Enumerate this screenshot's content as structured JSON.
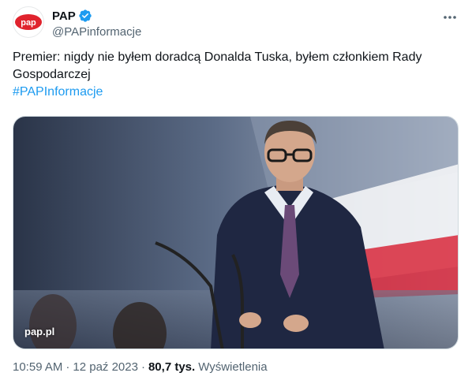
{
  "author": {
    "display_name": "PAP",
    "handle": "@PAPinformacje",
    "avatar_text": "pap",
    "verified_icon": "verified-badge-icon"
  },
  "tweet": {
    "text": "Premier: nigdy nie byłem doradcą Donalda Tuska, byłem członkiem Rady Gospodarczej",
    "hashtag": "#PAPInformacje"
  },
  "media": {
    "watermark": "pap.pl"
  },
  "meta": {
    "time": "10:59 AM",
    "date": "12 paź 2023",
    "separator": "·",
    "views_count": "80,7 tys.",
    "views_label": "Wyświetlenia"
  },
  "colors": {
    "accent": "#1d9bf0",
    "brand_red": "#e0232d",
    "secondary_text": "#536471"
  }
}
